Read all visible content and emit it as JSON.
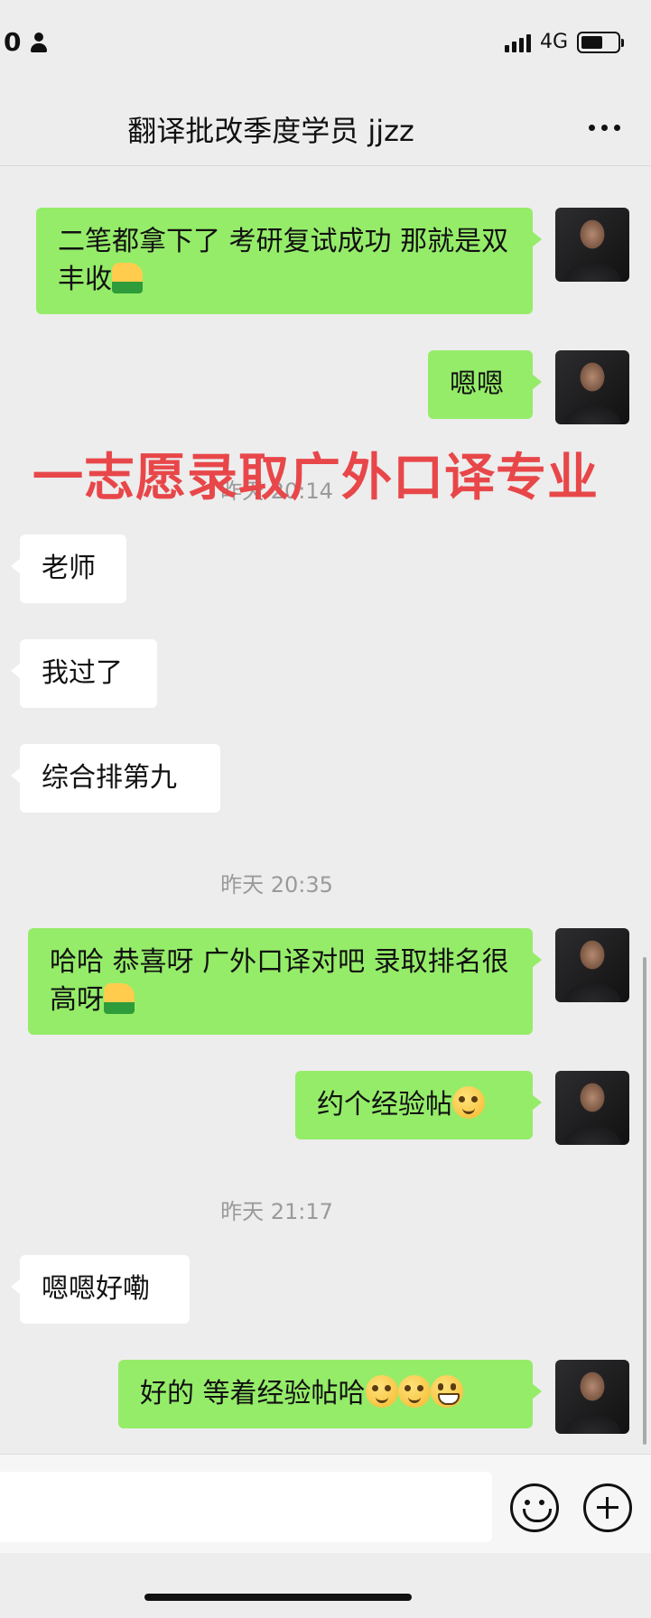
{
  "status_bar": {
    "left_text": "0",
    "network": "4G"
  },
  "header": {
    "title": "翻译批改季度学员 jjzz"
  },
  "overlay": {
    "text": "一志愿录取广外口译专业"
  },
  "messages": {
    "m1": {
      "side": "out",
      "text": "二笔都拿下了 考研复试成功 那就是双丰收",
      "emoji": [
        "thumbs-up"
      ]
    },
    "m2": {
      "side": "out",
      "text": "嗯嗯"
    },
    "t1": {
      "text": "昨天 20:14"
    },
    "m3": {
      "side": "in",
      "text": "老师"
    },
    "m4": {
      "side": "in",
      "text": "我过了"
    },
    "m5": {
      "side": "in",
      "text": "综合排第九"
    },
    "t2": {
      "text": "昨天 20:35"
    },
    "m6": {
      "side": "out",
      "text": "哈哈 恭喜呀 广外口译对吧 录取排名很高呀",
      "emoji": [
        "thumbs-up"
      ]
    },
    "m7": {
      "side": "out",
      "text": "约个经验帖",
      "emoji": [
        "smirk-face"
      ]
    },
    "t3": {
      "text": "昨天 21:17"
    },
    "m8": {
      "side": "in",
      "text": "嗯嗯好嘞"
    },
    "m9": {
      "side": "out",
      "text": "好的 等着经验帖哈",
      "emoji": [
        "smirk-face",
        "smirk-face",
        "grin-face"
      ]
    }
  },
  "colors": {
    "background": "#ededed",
    "outgoing_bubble": "#95ec69",
    "incoming_bubble": "#ffffff",
    "overlay_text": "#e8474a"
  }
}
